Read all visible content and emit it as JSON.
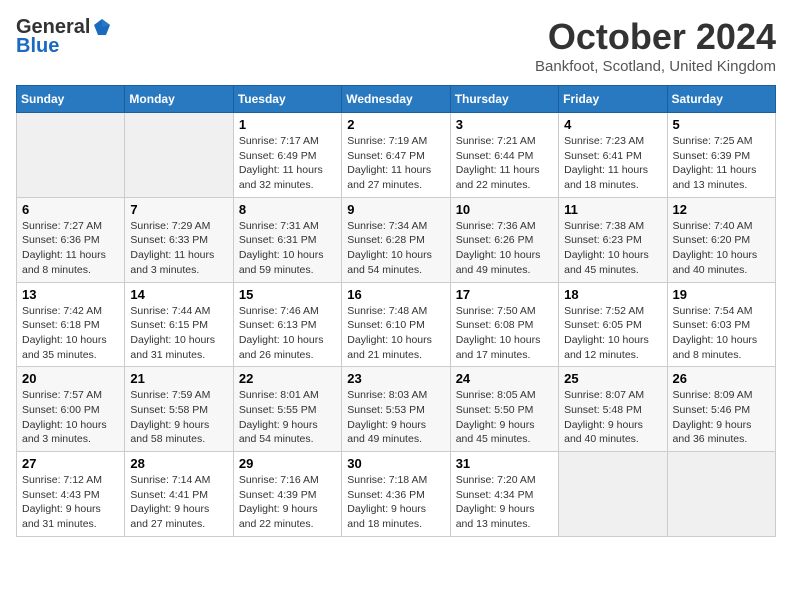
{
  "header": {
    "logo_general": "General",
    "logo_blue": "Blue",
    "month": "October 2024",
    "location": "Bankfoot, Scotland, United Kingdom"
  },
  "days_of_week": [
    "Sunday",
    "Monday",
    "Tuesday",
    "Wednesday",
    "Thursday",
    "Friday",
    "Saturday"
  ],
  "weeks": [
    [
      {
        "day": "",
        "content": ""
      },
      {
        "day": "",
        "content": ""
      },
      {
        "day": "1",
        "content": "Sunrise: 7:17 AM\nSunset: 6:49 PM\nDaylight: 11 hours and 32 minutes."
      },
      {
        "day": "2",
        "content": "Sunrise: 7:19 AM\nSunset: 6:47 PM\nDaylight: 11 hours and 27 minutes."
      },
      {
        "day": "3",
        "content": "Sunrise: 7:21 AM\nSunset: 6:44 PM\nDaylight: 11 hours and 22 minutes."
      },
      {
        "day": "4",
        "content": "Sunrise: 7:23 AM\nSunset: 6:41 PM\nDaylight: 11 hours and 18 minutes."
      },
      {
        "day": "5",
        "content": "Sunrise: 7:25 AM\nSunset: 6:39 PM\nDaylight: 11 hours and 13 minutes."
      }
    ],
    [
      {
        "day": "6",
        "content": "Sunrise: 7:27 AM\nSunset: 6:36 PM\nDaylight: 11 hours and 8 minutes."
      },
      {
        "day": "7",
        "content": "Sunrise: 7:29 AM\nSunset: 6:33 PM\nDaylight: 11 hours and 3 minutes."
      },
      {
        "day": "8",
        "content": "Sunrise: 7:31 AM\nSunset: 6:31 PM\nDaylight: 10 hours and 59 minutes."
      },
      {
        "day": "9",
        "content": "Sunrise: 7:34 AM\nSunset: 6:28 PM\nDaylight: 10 hours and 54 minutes."
      },
      {
        "day": "10",
        "content": "Sunrise: 7:36 AM\nSunset: 6:26 PM\nDaylight: 10 hours and 49 minutes."
      },
      {
        "day": "11",
        "content": "Sunrise: 7:38 AM\nSunset: 6:23 PM\nDaylight: 10 hours and 45 minutes."
      },
      {
        "day": "12",
        "content": "Sunrise: 7:40 AM\nSunset: 6:20 PM\nDaylight: 10 hours and 40 minutes."
      }
    ],
    [
      {
        "day": "13",
        "content": "Sunrise: 7:42 AM\nSunset: 6:18 PM\nDaylight: 10 hours and 35 minutes."
      },
      {
        "day": "14",
        "content": "Sunrise: 7:44 AM\nSunset: 6:15 PM\nDaylight: 10 hours and 31 minutes."
      },
      {
        "day": "15",
        "content": "Sunrise: 7:46 AM\nSunset: 6:13 PM\nDaylight: 10 hours and 26 minutes."
      },
      {
        "day": "16",
        "content": "Sunrise: 7:48 AM\nSunset: 6:10 PM\nDaylight: 10 hours and 21 minutes."
      },
      {
        "day": "17",
        "content": "Sunrise: 7:50 AM\nSunset: 6:08 PM\nDaylight: 10 hours and 17 minutes."
      },
      {
        "day": "18",
        "content": "Sunrise: 7:52 AM\nSunset: 6:05 PM\nDaylight: 10 hours and 12 minutes."
      },
      {
        "day": "19",
        "content": "Sunrise: 7:54 AM\nSunset: 6:03 PM\nDaylight: 10 hours and 8 minutes."
      }
    ],
    [
      {
        "day": "20",
        "content": "Sunrise: 7:57 AM\nSunset: 6:00 PM\nDaylight: 10 hours and 3 minutes."
      },
      {
        "day": "21",
        "content": "Sunrise: 7:59 AM\nSunset: 5:58 PM\nDaylight: 9 hours and 58 minutes."
      },
      {
        "day": "22",
        "content": "Sunrise: 8:01 AM\nSunset: 5:55 PM\nDaylight: 9 hours and 54 minutes."
      },
      {
        "day": "23",
        "content": "Sunrise: 8:03 AM\nSunset: 5:53 PM\nDaylight: 9 hours and 49 minutes."
      },
      {
        "day": "24",
        "content": "Sunrise: 8:05 AM\nSunset: 5:50 PM\nDaylight: 9 hours and 45 minutes."
      },
      {
        "day": "25",
        "content": "Sunrise: 8:07 AM\nSunset: 5:48 PM\nDaylight: 9 hours and 40 minutes."
      },
      {
        "day": "26",
        "content": "Sunrise: 8:09 AM\nSunset: 5:46 PM\nDaylight: 9 hours and 36 minutes."
      }
    ],
    [
      {
        "day": "27",
        "content": "Sunrise: 7:12 AM\nSunset: 4:43 PM\nDaylight: 9 hours and 31 minutes."
      },
      {
        "day": "28",
        "content": "Sunrise: 7:14 AM\nSunset: 4:41 PM\nDaylight: 9 hours and 27 minutes."
      },
      {
        "day": "29",
        "content": "Sunrise: 7:16 AM\nSunset: 4:39 PM\nDaylight: 9 hours and 22 minutes."
      },
      {
        "day": "30",
        "content": "Sunrise: 7:18 AM\nSunset: 4:36 PM\nDaylight: 9 hours and 18 minutes."
      },
      {
        "day": "31",
        "content": "Sunrise: 7:20 AM\nSunset: 4:34 PM\nDaylight: 9 hours and 13 minutes."
      },
      {
        "day": "",
        "content": ""
      },
      {
        "day": "",
        "content": ""
      }
    ]
  ]
}
